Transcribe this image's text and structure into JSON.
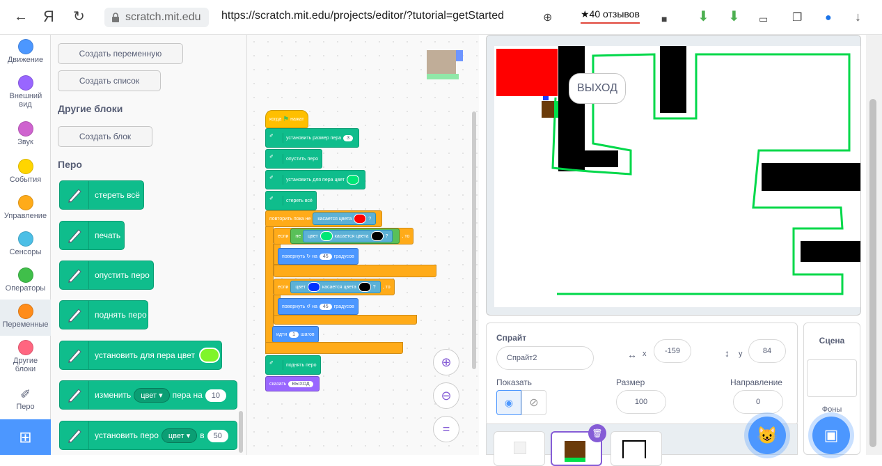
{
  "browser": {
    "domain": "scratch.mit.edu",
    "url": "https://scratch.mit.edu/projects/editor/?tutorial=getStarted",
    "reviews": "★40 отзывов",
    "logo": "Я"
  },
  "categories": [
    {
      "label": "Движение",
      "color": "#4c97ff"
    },
    {
      "label": "Внешний вид",
      "color": "#9966ff"
    },
    {
      "label": "Звук",
      "color": "#cf63cf"
    },
    {
      "label": "События",
      "color": "#ffd500"
    },
    {
      "label": "Управление",
      "color": "#ffab19"
    },
    {
      "label": "Сенсоры",
      "color": "#4cbfe6"
    },
    {
      "label": "Операторы",
      "color": "#40bf4a"
    },
    {
      "label": "Переменные",
      "color": "#ff8c1a"
    },
    {
      "label": "Другие блоки",
      "color": "#ff6680"
    },
    {
      "label": "Перо",
      "color": "#0fbd8c"
    }
  ],
  "palette": {
    "make_variable": "Создать переменную",
    "make_list": "Создать список",
    "my_blocks_heading": "Другие блоки",
    "make_block": "Создать блок",
    "pen_heading": "Перо",
    "blocks": {
      "clear": "стереть всё",
      "stamp": "печать",
      "pen_down": "опустить перо",
      "pen_up": "поднять перо",
      "set_color": "установить для пера цвет",
      "change_prefix": "изменить",
      "change_dropdown": "цвет",
      "change_mid": "пера на",
      "change_value": "10",
      "set_prefix": "установить перо",
      "set_dropdown": "цвет",
      "set_mid": "в",
      "set_value": "50"
    }
  },
  "script": {
    "when_flag": "когда",
    "clicked": "нажат",
    "set_size": "установить размер пера",
    "size_value": "3",
    "pen_down": "опустить перо",
    "set_color": "установить для пера цвет",
    "clear": "стереть всё",
    "repeat_until": "повторить пока не",
    "touching_color": "касается цвета",
    "q": "?",
    "if": "если",
    "not": "не",
    "color": "цвет",
    "then": ", то",
    "turn_right": "повернуть",
    "on": "на",
    "deg_value": "45",
    "degrees": "градусов",
    "move": "идти",
    "steps_value": "1",
    "steps": "шагов",
    "pen_up": "поднять перо",
    "say": "сказать",
    "say_value": "ВЫХОД"
  },
  "stage": {
    "speech": "ВЫХОД"
  },
  "sprite_info": {
    "sprite_label": "Спрайт",
    "sprite_name": "Спрайт2",
    "x_label": "x",
    "x_value": "-159",
    "y_label": "y",
    "y_value": "84",
    "show_label": "Показать",
    "size_label": "Размер",
    "size_value": "100",
    "direction_label": "Направление",
    "direction_value": "0"
  },
  "stage_panel": {
    "title": "Сцена",
    "backdrops": "Фоны"
  }
}
